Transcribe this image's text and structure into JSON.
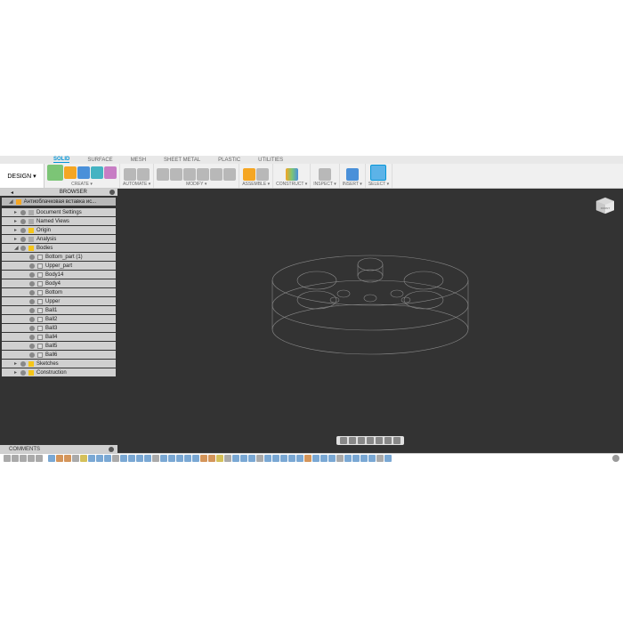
{
  "tabs": [
    "SOLID",
    "SURFACE",
    "MESH",
    "SHEET METAL",
    "PLASTIC",
    "UTILITIES"
  ],
  "active_tab": "SOLID",
  "design_label": "DESIGN ▾",
  "ribbon_groups": {
    "create": "CREATE ▾",
    "automate": "AUTOMATE ▾",
    "modify": "MODIFY ▾",
    "assemble": "ASSEMBLE ▾",
    "construct": "CONSTRUCT ▾",
    "inspect": "INSPECT ▾",
    "insert": "INSERT ▾",
    "select": "SELECT ▾"
  },
  "browser": {
    "title": "BROWSER",
    "root": "Антиоблачковая вставка ис...",
    "items": [
      {
        "label": "Document Settings",
        "lvl": 1,
        "exp": 1
      },
      {
        "label": "Named Views",
        "lvl": 1,
        "exp": 1
      },
      {
        "label": "Origin",
        "lvl": 1,
        "exp": 1,
        "ico": "y"
      },
      {
        "label": "Analysis",
        "lvl": 1,
        "exp": 1
      },
      {
        "label": "Bodies",
        "lvl": 1,
        "exp": 1,
        "open": true,
        "ico": "y"
      },
      {
        "label": "Bottom_part (1)",
        "lvl": 2,
        "ico": "c"
      },
      {
        "label": "Upper_part",
        "lvl": 2,
        "ico": "c"
      },
      {
        "label": "Body14",
        "lvl": 2,
        "ico": "c"
      },
      {
        "label": "Body4",
        "lvl": 2,
        "ico": "c"
      },
      {
        "label": "Bottom",
        "lvl": 2,
        "ico": "c"
      },
      {
        "label": "Upper",
        "lvl": 2,
        "ico": "c"
      },
      {
        "label": "Ball1",
        "lvl": 2,
        "ico": "c"
      },
      {
        "label": "Ball2",
        "lvl": 2,
        "ico": "c"
      },
      {
        "label": "Ball3",
        "lvl": 2,
        "ico": "c"
      },
      {
        "label": "Ball4",
        "lvl": 2,
        "ico": "c"
      },
      {
        "label": "Ball5",
        "lvl": 2,
        "ico": "c"
      },
      {
        "label": "Ball6",
        "lvl": 2,
        "ico": "c"
      },
      {
        "label": "Sketches",
        "lvl": 1,
        "exp": 1,
        "ico": "y"
      },
      {
        "label": "Construction",
        "lvl": 1,
        "exp": 1,
        "ico": "y"
      }
    ]
  },
  "comments_label": "COMMENTS",
  "viewcube_face": "FRONT"
}
